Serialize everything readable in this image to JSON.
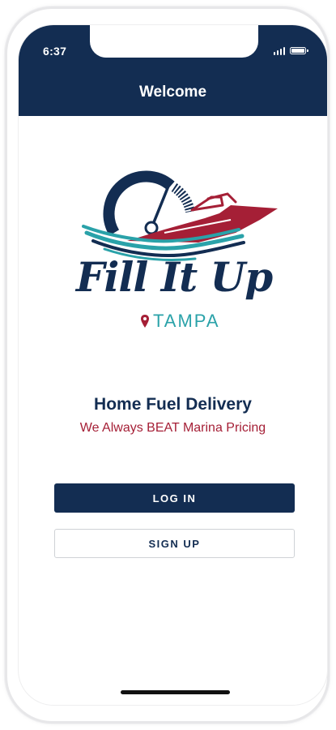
{
  "status_bar": {
    "time": "6:37"
  },
  "header": {
    "title": "Welcome"
  },
  "logo": {
    "wordmark": "Fill It Up",
    "city": "TAMPA"
  },
  "taglines": {
    "main": "Home Fuel Delivery",
    "sub": "We Always BEAT Marina Pricing"
  },
  "actions": {
    "login_label": "LOG IN",
    "signup_label": "SIGN UP"
  },
  "colors": {
    "navy": "#132d52",
    "crimson": "#a51f36",
    "teal": "#2aa2a9"
  },
  "icons": {
    "signal": "signal-icon",
    "battery": "battery-icon",
    "pin": "location-pin-icon",
    "gauge": "gauge-icon",
    "boat": "boat-icon",
    "waves": "waves-icon"
  }
}
